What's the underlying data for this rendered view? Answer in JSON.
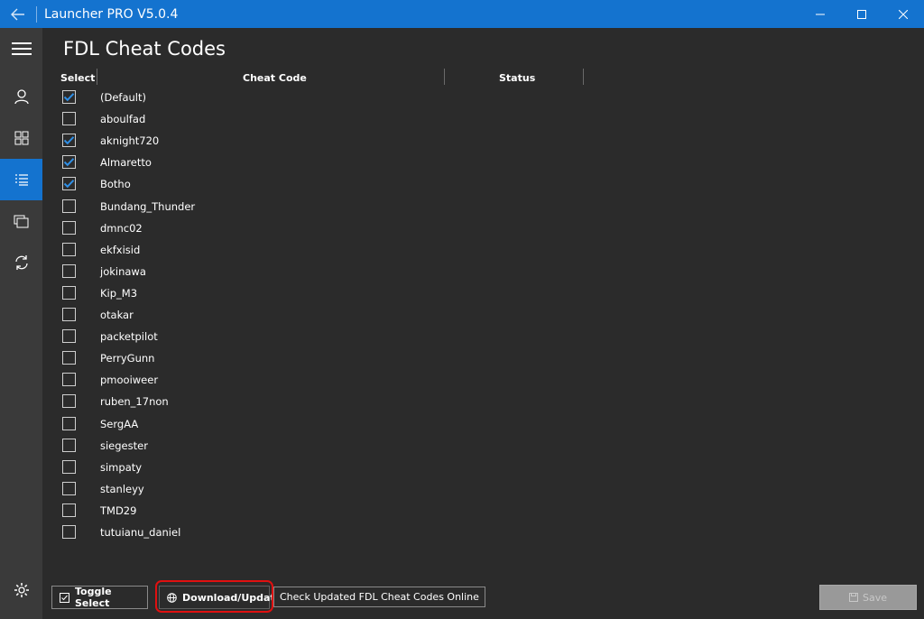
{
  "window": {
    "title": "Launcher PRO V5.0.4"
  },
  "sidebar": {
    "items": [
      {
        "icon": "hamburger-menu-icon"
      },
      {
        "icon": "user-icon"
      },
      {
        "icon": "grid-icon"
      },
      {
        "icon": "list-icon",
        "active": true
      },
      {
        "icon": "copy-pages-icon"
      },
      {
        "icon": "sync-icon"
      },
      {
        "icon": "gear-icon"
      }
    ]
  },
  "main": {
    "title": "FDL Cheat Codes",
    "columns": {
      "select": "Select",
      "cheat_code": "Cheat Code",
      "status": "Status"
    },
    "rows": [
      {
        "name": "(Default)",
        "checked": true
      },
      {
        "name": "aboulfad",
        "checked": false
      },
      {
        "name": "aknight720",
        "checked": true
      },
      {
        "name": "Almaretto",
        "checked": true
      },
      {
        "name": "Botho",
        "checked": true
      },
      {
        "name": "Bundang_Thunder",
        "checked": false
      },
      {
        "name": "dmnc02",
        "checked": false
      },
      {
        "name": "ekfxisid",
        "checked": false
      },
      {
        "name": "jokinawa",
        "checked": false
      },
      {
        "name": "Kip_M3",
        "checked": false
      },
      {
        "name": "otakar",
        "checked": false
      },
      {
        "name": "packetpilot",
        "checked": false
      },
      {
        "name": "PerryGunn",
        "checked": false
      },
      {
        "name": "pmooiweer",
        "checked": false
      },
      {
        "name": "ruben_17non",
        "checked": false
      },
      {
        "name": "SergAA",
        "checked": false
      },
      {
        "name": "siegester",
        "checked": false
      },
      {
        "name": "simpaty",
        "checked": false
      },
      {
        "name": "stanleyy",
        "checked": false
      },
      {
        "name": "TMD29",
        "checked": false
      },
      {
        "name": "tutuianu_daniel",
        "checked": false
      }
    ]
  },
  "footer": {
    "toggle_select_label": "Toggle Select",
    "download_update_label": "Download/Update",
    "download_hint": "Check Updated FDL Cheat Codes Online",
    "save_label": "Save"
  },
  "colors": {
    "titlebar": "#1473cf",
    "accent": "#1473cf",
    "background": "#2b2b2b",
    "sidebar": "#3a3a3a",
    "highlight": "#e01010"
  }
}
